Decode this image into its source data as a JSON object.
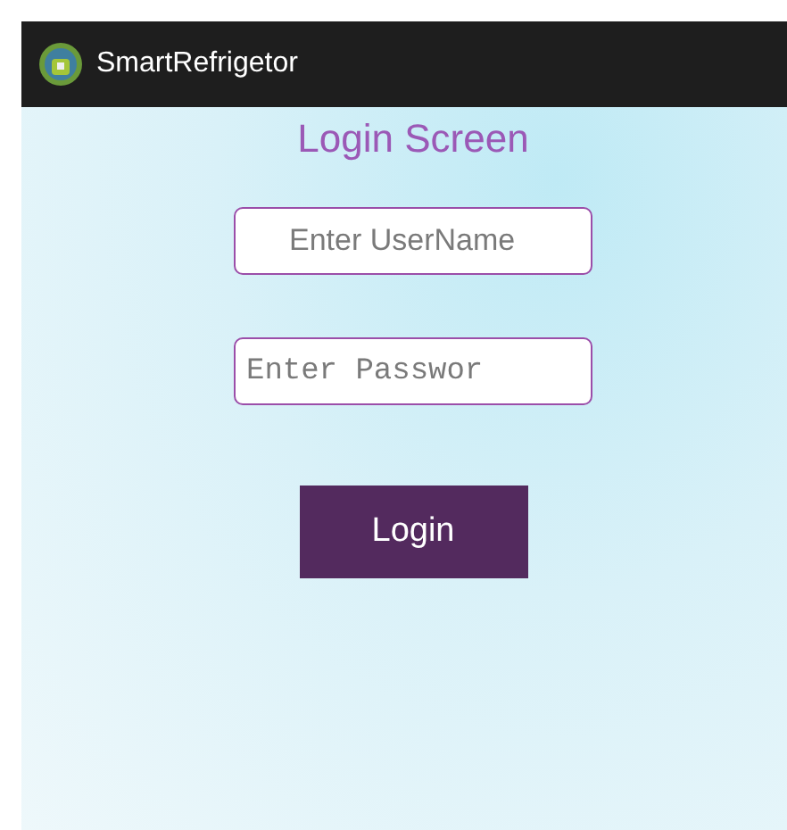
{
  "app_bar": {
    "title": "SmartRefrigetor"
  },
  "screen_title": "Login Screen",
  "fields": [
    {
      "kind": "text",
      "placeholder": "Enter UserName"
    },
    {
      "kind": "password",
      "placeholder": "Enter Passwor"
    }
  ],
  "login_button": "Login"
}
